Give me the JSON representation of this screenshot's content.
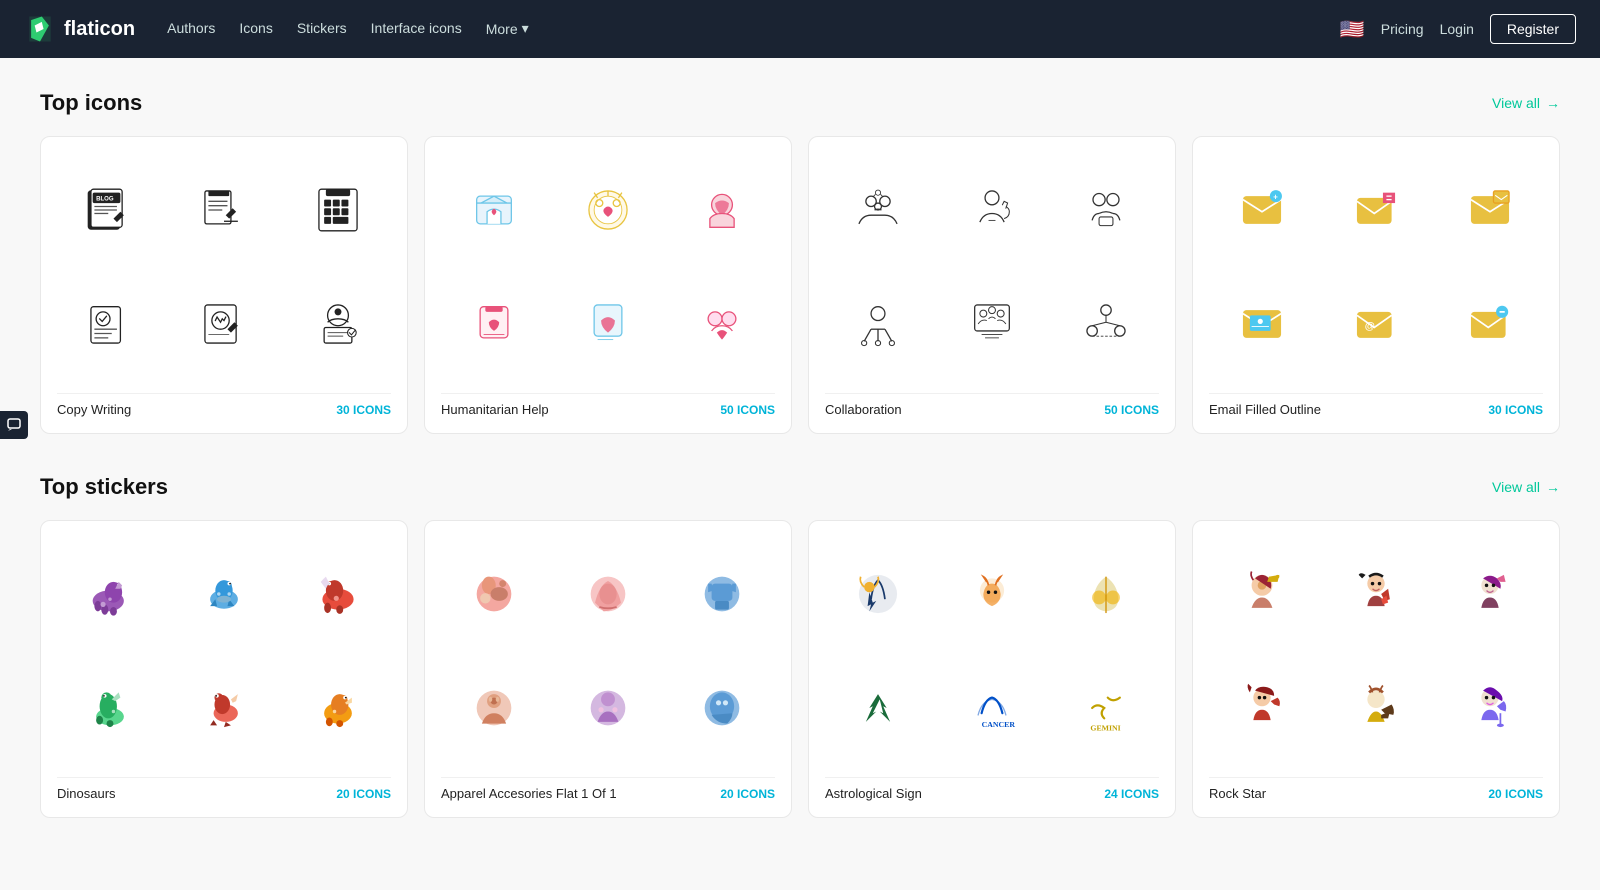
{
  "nav": {
    "logo_text": "flaticon",
    "links": [
      "Authors",
      "Icons",
      "Stickers",
      "Interface icons",
      "More"
    ],
    "more_label": "More",
    "pricing_label": "Pricing",
    "login_label": "Login",
    "register_label": "Register"
  },
  "sections": {
    "top_icons": {
      "title": "Top icons",
      "view_all": "View all",
      "packs": [
        {
          "name": "Copy Writing",
          "count": "30 ICONS",
          "style": "mono"
        },
        {
          "name": "Humanitarian Help",
          "count": "50 ICONS",
          "style": "color"
        },
        {
          "name": "Collaboration",
          "count": "50 ICONS",
          "style": "outline"
        },
        {
          "name": "Email Filled Outline",
          "count": "30 ICONS",
          "style": "email"
        }
      ]
    },
    "top_stickers": {
      "title": "Top stickers",
      "view_all": "View all",
      "packs": [
        {
          "name": "Dinosaurs",
          "count": "20 ICONS",
          "style": "dino"
        },
        {
          "name": "Apparel Accesories Flat 1 Of 1",
          "count": "20 ICONS",
          "style": "apparel"
        },
        {
          "name": "Astrological Sign",
          "count": "24 ICONS",
          "style": "astro"
        },
        {
          "name": "Rock Star",
          "count": "20 ICONS",
          "style": "rock"
        }
      ]
    }
  }
}
